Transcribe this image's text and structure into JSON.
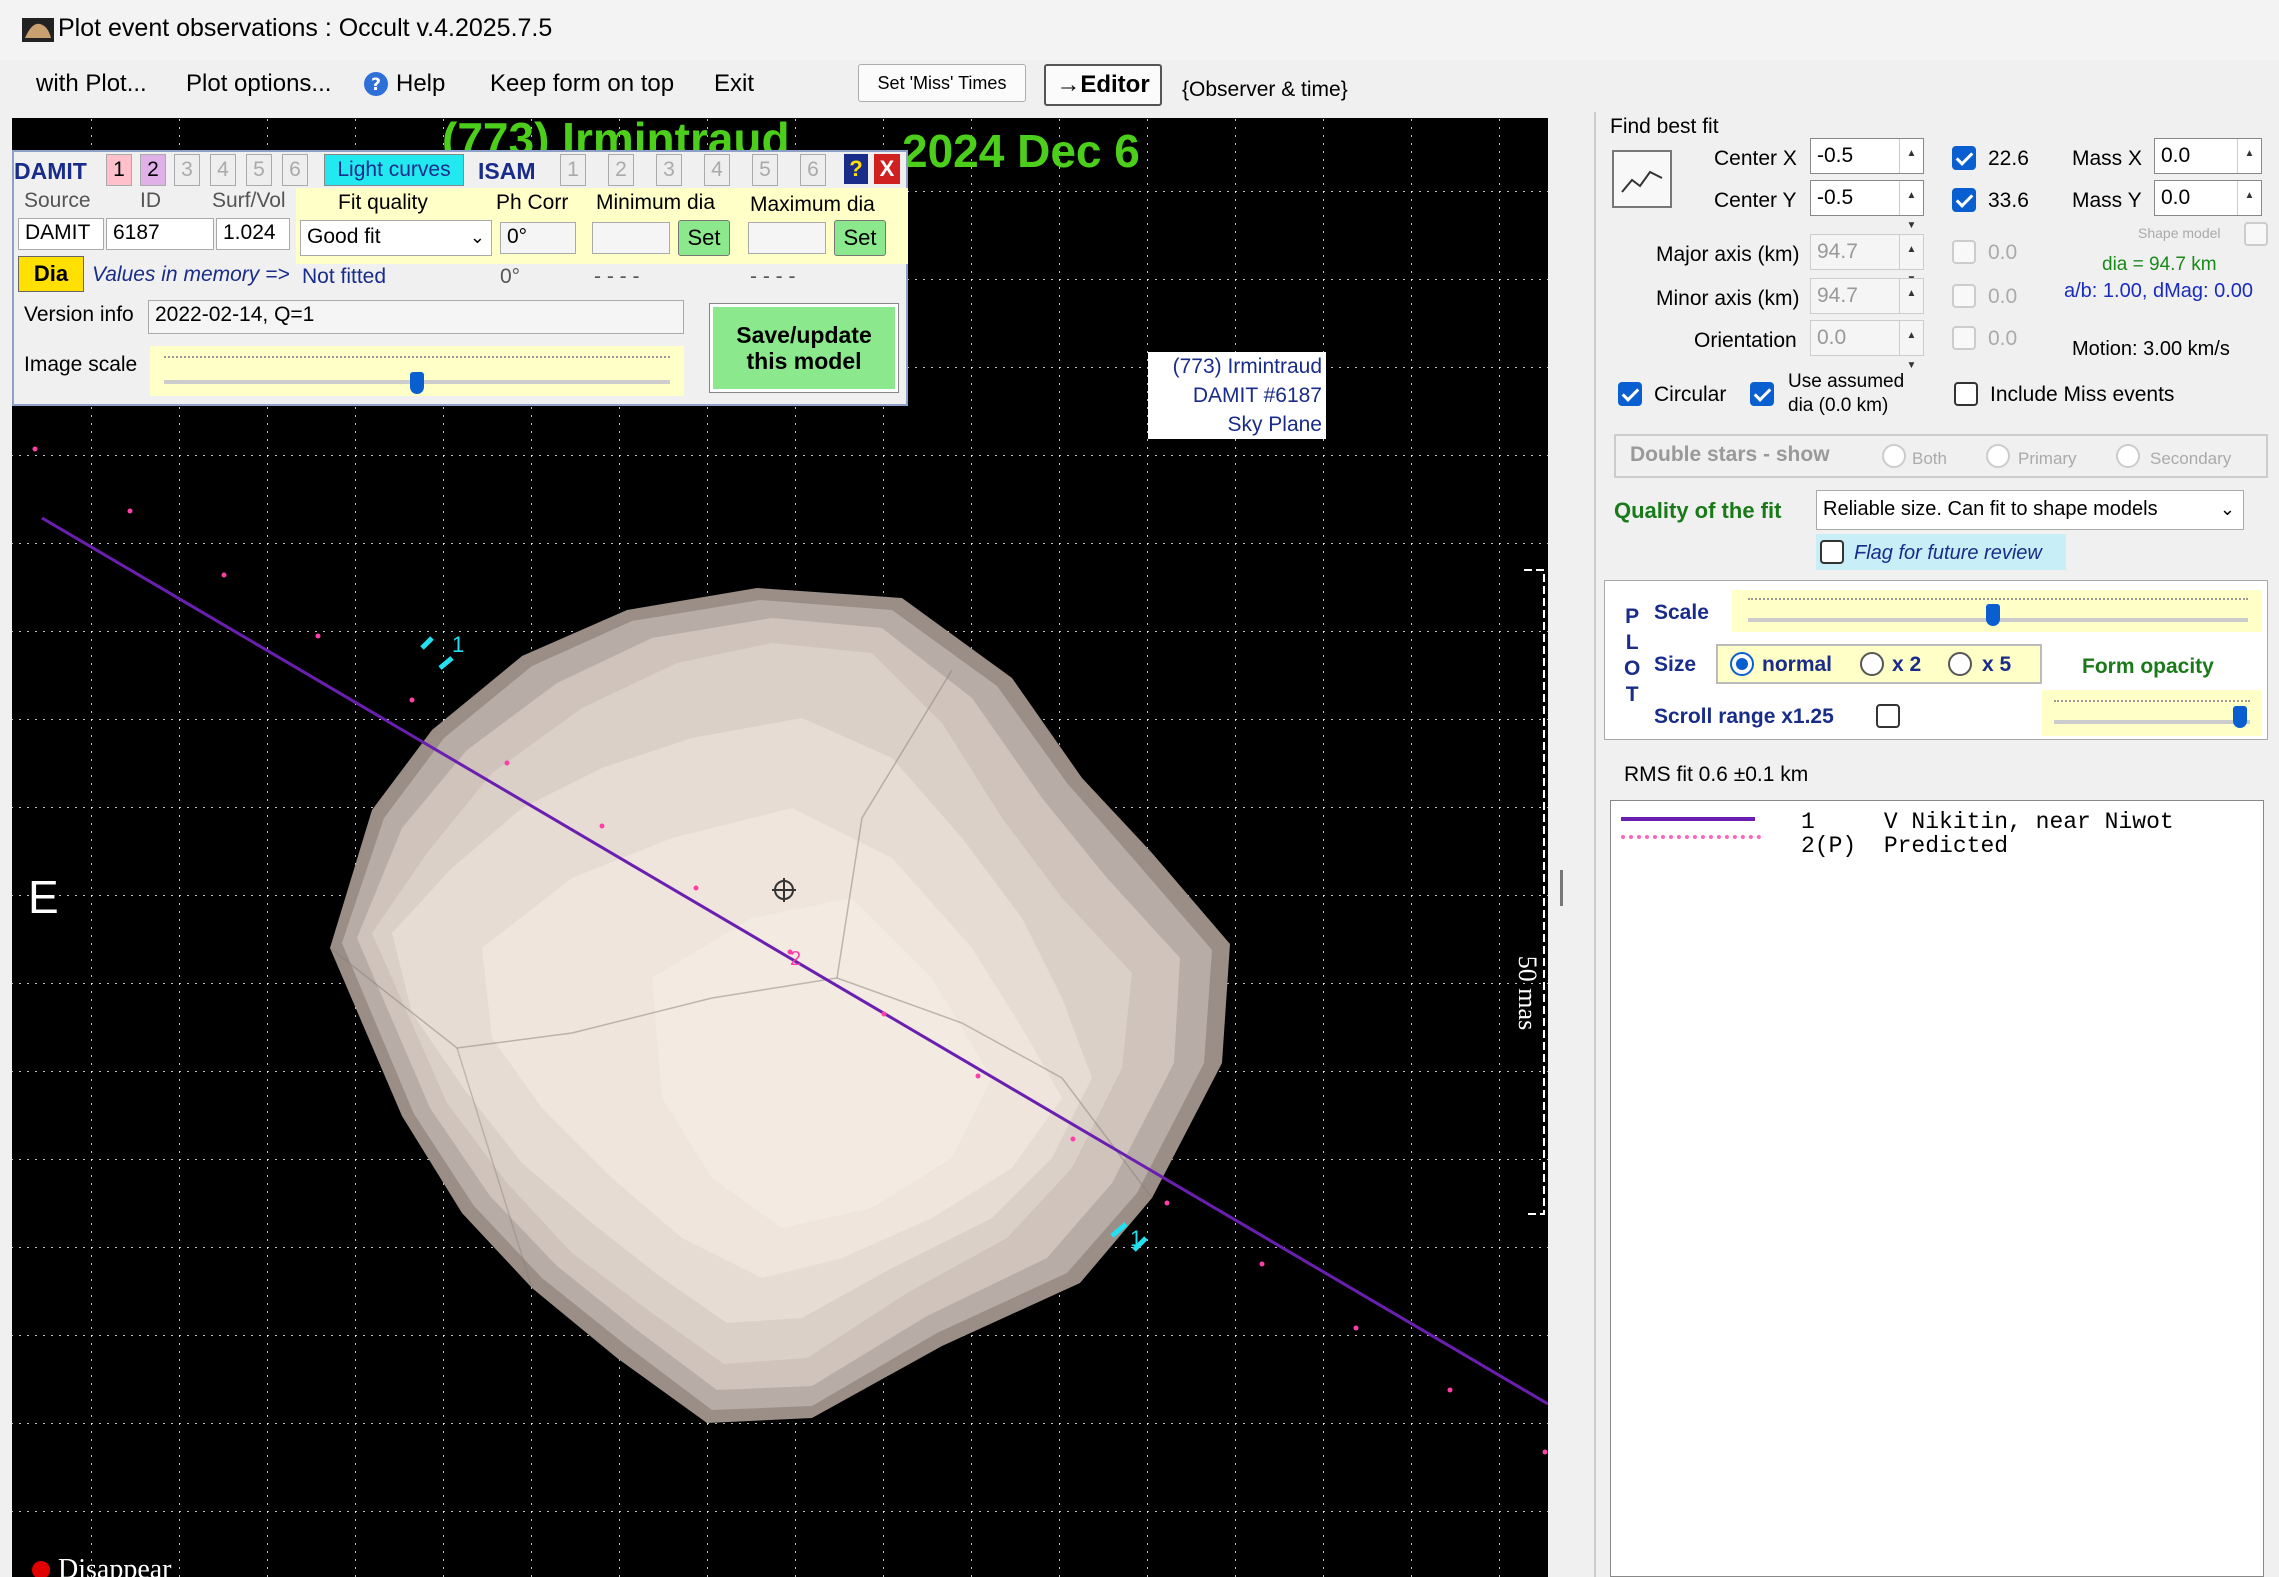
{
  "window": {
    "title": "Plot event observations : Occult v.4.2025.7.5",
    "app_icon": "occult-app-icon"
  },
  "menu": {
    "with_plot": "with Plot...",
    "plot_options": "Plot options...",
    "help": "Help",
    "keep_on_top": "Keep form on top",
    "exit": "Exit",
    "set_miss_times": "Set 'Miss' Times",
    "editor": "→Editor",
    "observer_time": "{Observer & time}"
  },
  "plot": {
    "title_fragment_left": "(773) Irmintraud",
    "title_fragment_right": "2024 Dec 6",
    "east_label": "E",
    "scale_label": "50 mas",
    "chord_label_1a": "1",
    "chord_label_1b": "1",
    "predicted_label": "2",
    "object_label": {
      "line1": "(773) Irmintraud",
      "line2": "DAMIT #6187",
      "line3": "Sky Plane"
    },
    "bottom_legend": "Disappear",
    "colors": {
      "background": "#000000",
      "grid": "#ffffff",
      "chord": "#6a1fb0",
      "predicted": "#ff3fa8",
      "shape": "#e9ddd4",
      "title": "#4ccf1a"
    }
  },
  "overlay": {
    "damit": "DAMIT",
    "damit_nums": [
      "1",
      "2",
      "3",
      "4",
      "5",
      "6"
    ],
    "light_curves": "Light curves",
    "isam": "ISAM",
    "isam_nums": [
      "1",
      "2",
      "3",
      "4",
      "5",
      "6"
    ],
    "help_btn": "?",
    "close_btn": "X",
    "headers": {
      "source": "Source",
      "id": "ID",
      "surf_vol": "Surf/Vol",
      "fit_quality": "Fit quality",
      "ph_corr": "Ph Corr",
      "min_dia": "Minimum dia",
      "max_dia": "Maximum dia"
    },
    "source_value": "DAMIT",
    "id_value": "6187",
    "surf_vol_value": "1.024",
    "fit_quality_value": "Good fit",
    "ph_corr_value": "0°",
    "set": "Set",
    "dia_btn": "Dia",
    "values_in_memory": "Values in memory =>",
    "not_fitted": "Not fitted",
    "ph_corr_mem": "0°",
    "dashes": "- - - -",
    "version_info_label": "Version info",
    "version_info_value": "2022-02-14, Q=1",
    "save_update": "Save/update this model",
    "image_scale": "Image scale",
    "image_scale_level": 0.5
  },
  "right": {
    "find_best_fit": "Find best fit",
    "center_x_label": "Center X",
    "center_x": "-0.5",
    "center_y_label": "Center Y",
    "center_y": "-0.5",
    "chk_x_value": "22.6",
    "chk_y_value": "33.6",
    "mass_x_label": "Mass X",
    "mass_x": "0.0",
    "mass_y_label": "Mass Y",
    "mass_y": "0.0",
    "shape_model": "Shape model",
    "major_axis_label": "Major axis (km)",
    "major_axis": "94.7",
    "minor_axis_label": "Minor axis (km)",
    "minor_axis": "94.7",
    "orientation_label": "Orientation",
    "orientation": "0.0",
    "dis_val_1": "0.0",
    "dis_val_2": "0.0",
    "dis_val_3": "0.0",
    "dia_text": "dia = 94.7 km",
    "ab_text": "a/b: 1.00, dMag: 0.00",
    "motion_text": "Motion: 3.00 km/s",
    "circular": "Circular",
    "use_assumed": "Use assumed",
    "use_assumed_dia": "dia (0.0 km)",
    "include_miss": "Include Miss events",
    "double_stars": "Double stars - show",
    "both": "Both",
    "primary": "Primary",
    "secondary": "Secondary",
    "quality_label": "Quality of the fit",
    "quality_value": "Reliable size. Can fit to shape models",
    "flag_review": "Flag for future review",
    "plot_letters": [
      "P",
      "L",
      "O",
      "T"
    ],
    "scale": "Scale",
    "scale_level": 0.49,
    "size": "Size",
    "size_normal": "normal",
    "size_x2": "x 2",
    "size_x5": "x 5",
    "form_opacity": "Form opacity",
    "opacity_level": 0.95,
    "scroll_range": "Scroll range x1.25",
    "rms_fit": "RMS fit 0.6 ±0.1 km",
    "legend": [
      {
        "num": "1",
        "name": "V Nikitin, near Niwot"
      },
      {
        "num": "2(P)",
        "name": "Predicted"
      }
    ]
  }
}
